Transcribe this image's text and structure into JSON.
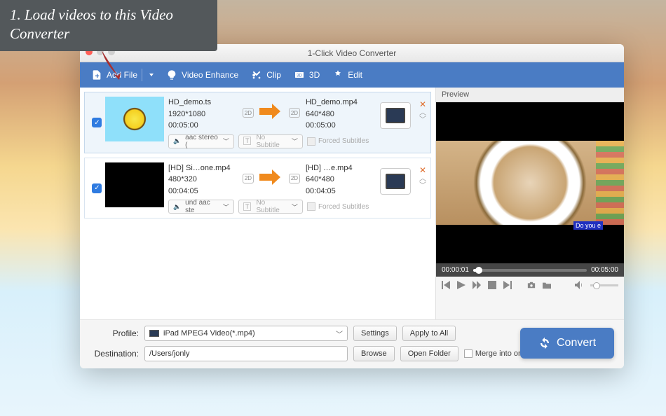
{
  "annotation": {
    "text": "1. Load videos to this Video Converter"
  },
  "window": {
    "title": "1-Click Video Converter"
  },
  "toolbar": {
    "add_file": "Add File",
    "video_enhance": "Video Enhance",
    "clip": "Clip",
    "three_d": "3D",
    "edit": "Edit"
  },
  "items": [
    {
      "in_name": "HD_demo.ts",
      "in_res": "1920*1080",
      "in_dur": "00:05:00",
      "out_name": "HD_demo.mp4",
      "out_res": "640*480",
      "out_dur": "00:05:00",
      "badge_in": "2D",
      "badge_out": "2D",
      "audio": "aac stereo (",
      "subtitle": "No Subtitle",
      "forced": "Forced Subtitles",
      "thumb": "sun",
      "selected": true
    },
    {
      "in_name": "[HD] Si…one.mp4",
      "in_res": "480*320",
      "in_dur": "00:04:05",
      "out_name": "[HD] …e.mp4",
      "out_res": "640*480",
      "out_dur": "00:04:05",
      "badge_in": "2D",
      "badge_out": "2D",
      "audio": "und aac ste",
      "subtitle": "No Subtitle",
      "forced": "Forced Subtitles",
      "thumb": "black",
      "selected": false
    }
  ],
  "preview": {
    "title": "Preview",
    "current": "00:00:01",
    "total": "00:05:00",
    "overlay_text": "Do you e"
  },
  "bottom": {
    "profile_label": "Profile:",
    "profile_value": "iPad MPEG4 Video(*.mp4)",
    "dest_label": "Destination:",
    "dest_value": "/Users/jonly",
    "settings": "Settings",
    "apply_all": "Apply to All",
    "browse": "Browse",
    "open_folder": "Open Folder",
    "merge": "Merge into one file",
    "convert": "Convert"
  },
  "icons": {
    "device_hint": "ipad-thumb"
  }
}
